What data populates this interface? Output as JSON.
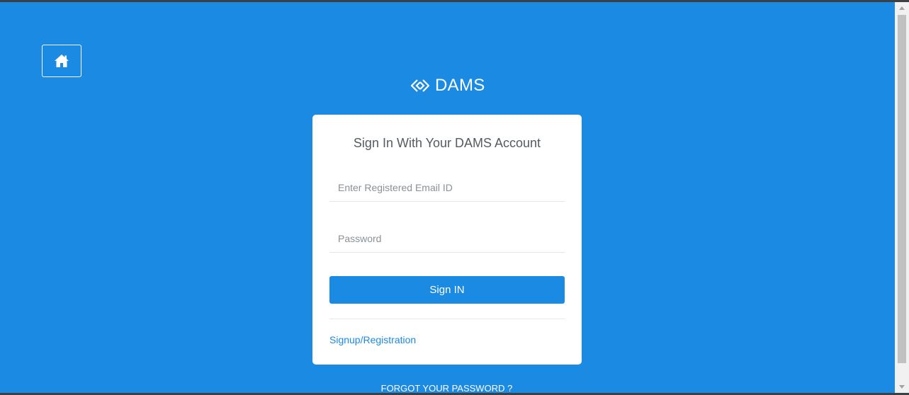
{
  "brand": {
    "name": "DAMS"
  },
  "login": {
    "title": "Sign In With Your DAMS Account",
    "email_placeholder": "Enter Registered Email ID",
    "password_placeholder": "Password",
    "signin_label": "Sign IN",
    "signup_label": "Signup/Registration",
    "forgot_label": "FORGOT YOUR PASSWORD ?"
  },
  "colors": {
    "background": "#1a8ae3",
    "button": "#1a8ae3",
    "card": "#ffffff",
    "link": "#1a8ae3"
  },
  "icons": {
    "home": "home-icon",
    "logo": "dams-logo-icon"
  }
}
